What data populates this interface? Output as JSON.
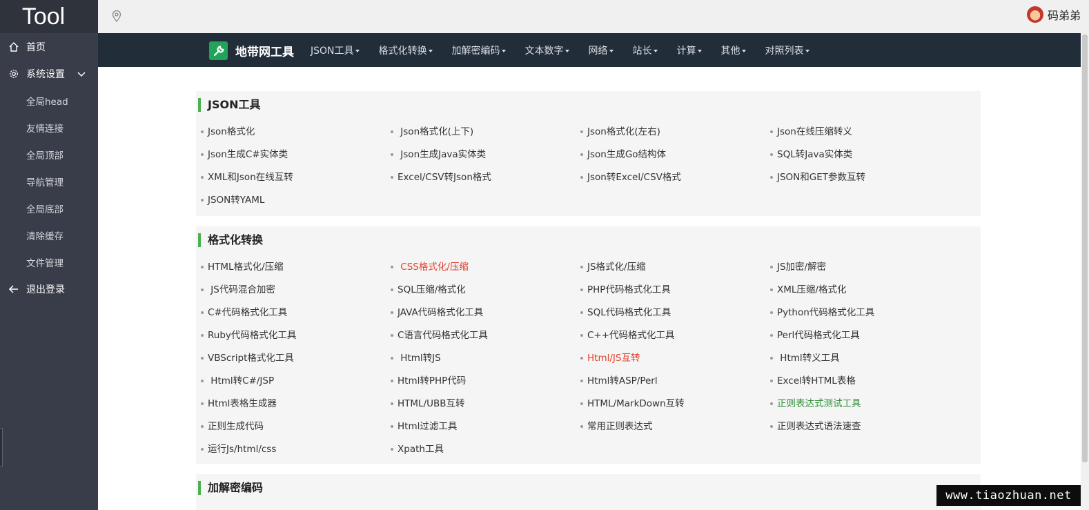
{
  "app": {
    "brand": "Tool"
  },
  "sidebar": {
    "items": [
      {
        "label": "首页",
        "icon": "home-icon",
        "type": "top"
      },
      {
        "label": "系统设置",
        "icon": "gear-icon",
        "type": "top",
        "expanded": true
      },
      {
        "label": "全局head",
        "type": "sub"
      },
      {
        "label": "友情连接",
        "type": "sub"
      },
      {
        "label": "全局顶部",
        "type": "sub"
      },
      {
        "label": "导航管理",
        "type": "sub"
      },
      {
        "label": "全局底部",
        "type": "sub"
      },
      {
        "label": "清除缓存",
        "type": "sub"
      },
      {
        "label": "文件管理",
        "type": "sub"
      },
      {
        "label": "退出登录",
        "icon": "arrow-left-icon",
        "type": "top"
      }
    ]
  },
  "topbar": {
    "location_icon": "location-pin-icon",
    "username": "码弟弟"
  },
  "site": {
    "logo_text": "地带网工具",
    "menu": [
      "JSON工具",
      "格式化转换",
      "加解密编码",
      "文本数字",
      "网络",
      "站长",
      "计算",
      "其他",
      "对照列表"
    ]
  },
  "sections": [
    {
      "title": "JSON工具",
      "rows": [
        [
          "Json格式化",
          " Json格式化(上下)",
          "Json格式化(左右)",
          "Json在线压缩转义"
        ],
        [
          "Json生成C#实体类",
          " Json生成Java实体类",
          "Json生成Go结构体",
          "SQL转Java实体类"
        ],
        [
          "XML和Json在线互转",
          "Excel/CSV转Json格式",
          "Json转Excel/CSV格式",
          "JSON和GET参数互转"
        ],
        [
          "JSON转YAML"
        ]
      ]
    },
    {
      "title": "格式化转换",
      "rows": [
        [
          "HTML格式化/压缩",
          " CSS格式化/压缩",
          "JS格式化/压缩",
          "JS加密/解密"
        ],
        [
          " JS代码混合加密",
          "SQL压缩/格式化",
          "PHP代码格式化工具",
          "XML压缩/格式化"
        ],
        [
          "C#代码格式化工具",
          "JAVA代码格式化工具",
          "SQL代码格式化工具",
          "Python代码格式化工具"
        ],
        [
          "Ruby代码格式化工具",
          "C语言代码格式化工具",
          "C++代码格式化工具",
          "Perl代码格式化工具"
        ],
        [
          "VBScript格式化工具",
          " Html转JS",
          "Html/JS互转",
          " Html转义工具"
        ],
        [
          " Html转C#/JSP",
          "Html转PHP代码",
          "Html转ASP/Perl",
          "Excel转HTML表格"
        ],
        [
          "Html表格生成器",
          "HTML/UBB互转",
          "HTML/MarkDown互转",
          "正则表达式测试工具"
        ],
        [
          "正则生成代码",
          "Html过滤工具",
          "常用正则表达式",
          "正则表达式语法速查"
        ],
        [
          "运行Js/html/css",
          "Xpath工具"
        ]
      ],
      "highlight": {
        "red": [
          " CSS格式化/压缩",
          "Html/JS互转"
        ],
        "green": [
          "正则表达式测试工具"
        ]
      }
    },
    {
      "title": "加解密编码",
      "rows": []
    }
  ],
  "watermark": "www.tiaozhuan.net",
  "colors": {
    "sidebar_bg": "#393d49",
    "nav_bg": "#222d3a",
    "accent_green": "#4caf50",
    "link_red": "#e0412d",
    "link_green": "#2c8f35"
  }
}
